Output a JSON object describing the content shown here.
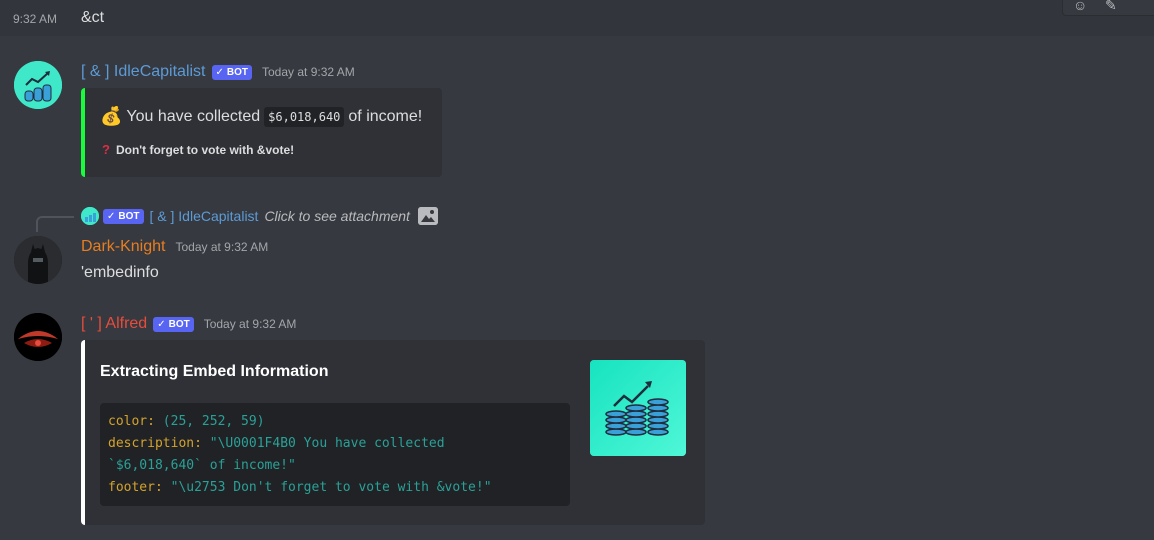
{
  "top": {
    "timestamp": "9:32 AM",
    "content": "&ct"
  },
  "msg1": {
    "username": "[ & ] IdleCapitalist",
    "bot_label": "BOT",
    "timestamp": "Today at 9:32 AM",
    "embed": {
      "desc_prefix": "You have collected",
      "amount": "$6,018,640",
      "desc_suffix": "of income!",
      "footer": "Don't forget to vote with &vote!",
      "color": "#19fc3b"
    }
  },
  "reply": {
    "bot_label": "BOT",
    "username": "[ & ] IdleCapitalist",
    "text": "Click to see attachment"
  },
  "msg2": {
    "username": "Dark-Knight",
    "timestamp": "Today at 9:32 AM",
    "content": "'embedinfo"
  },
  "msg3": {
    "username": "[ ' ] Alfred",
    "bot_label": "BOT",
    "timestamp": "Today at 9:32 AM",
    "embed": {
      "title": "Extracting Embed Information",
      "code_lines": [
        {
          "key": "color:",
          "value": " (25, 252, 59)"
        },
        {
          "key": "description:",
          "value": " \"\\U0001F4B0 You have collected"
        },
        {
          "key": "",
          "value": "`$6,018,640` of income!\""
        },
        {
          "key": "footer:",
          "value": " \"\\u2753 Don't forget to vote with &vote!\""
        }
      ]
    }
  },
  "colors": {
    "idlecapitalist_name": "#5c9bd6",
    "darkknight_name": "#e67e22",
    "alfred_name": "#e74c3c",
    "bot_tag": "#5865f2"
  }
}
